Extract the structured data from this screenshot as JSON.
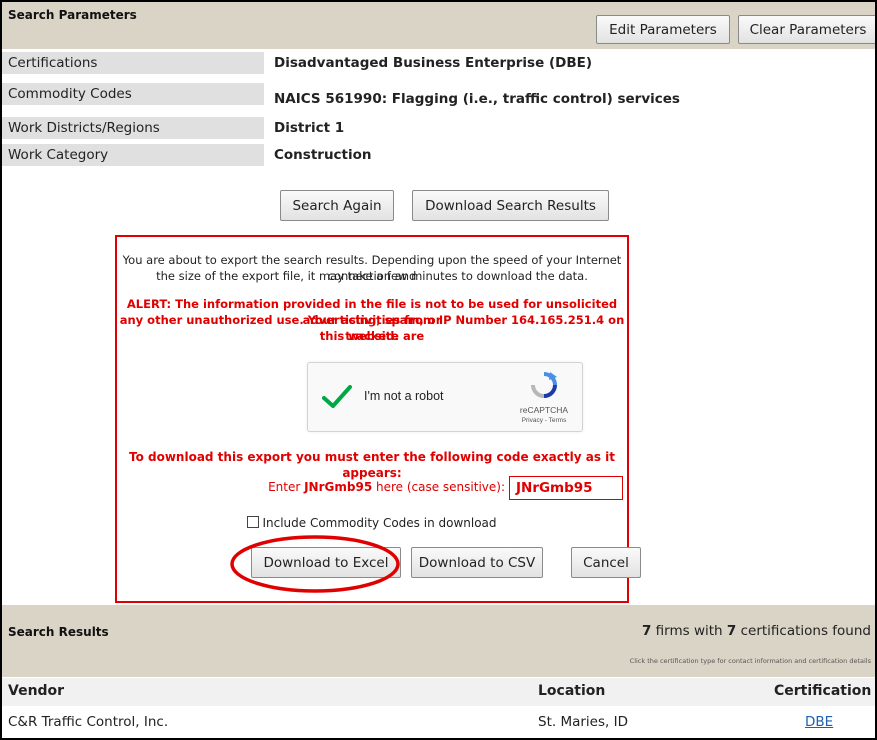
{
  "search_params": {
    "title": "Search Parameters",
    "edit_label": "Edit Parameters",
    "clear_label": "Clear Parameters",
    "rows": [
      {
        "label": "Certifications",
        "value": "Disadvantaged Business Enterprise (DBE)"
      },
      {
        "label": "Commodity Codes",
        "value": "NAICS 561990: Flagging (i.e., traffic control) services"
      },
      {
        "label": "Work Districts/Regions",
        "value": "District 1"
      },
      {
        "label": "Work Category",
        "value": "Construction"
      }
    ],
    "search_again_label": "Search Again",
    "download_results_label": "Download Search Results"
  },
  "export_dialog": {
    "intro_line1": "You are about to export the search results. Depending upon the speed of your Internet connection and",
    "intro_line2": "the size of the export file, it may take a few minutes to download the data.",
    "alert_line1": "ALERT: The information provided in the file is not to be used for unsolicited advertising, spam, or",
    "alert_line2": "any other unauthorized use. Your activities from IP Number 164.165.251.4 on this website are",
    "alert_line3": "tracked.",
    "captcha_label": "I'm not a robot",
    "captcha_brand": "reCAPTCHA",
    "captcha_links": "Privacy - Terms",
    "code_instruction": "To download this export you must enter the following code exactly as it appears:",
    "enter_prefix": "Enter ",
    "code": "JNrGmb95",
    "enter_suffix": " here (case sensitive):",
    "code_input_value": "JNrGmb95",
    "include_label": "Include Commodity Codes in download",
    "excel_label": "Download to Excel",
    "csv_label": "Download to CSV",
    "cancel_label": "Cancel"
  },
  "results": {
    "title": "Search Results",
    "firms_count": "7",
    "firms_text": " firms with ",
    "cert_count": "7",
    "cert_text": " certifications found",
    "hint": "Click the certification type for contact information and certification details",
    "columns": [
      "Vendor",
      "Location",
      "Certification"
    ],
    "rows": [
      {
        "vendor": "C&R Traffic Control, Inc.",
        "location": "St. Maries, ID",
        "certification": "DBE"
      }
    ]
  },
  "colors": {
    "alert_red": "#e00000",
    "header_bar": "#d9d4c5",
    "link_blue": "#1a5fb4",
    "check_green": "#00a845"
  }
}
